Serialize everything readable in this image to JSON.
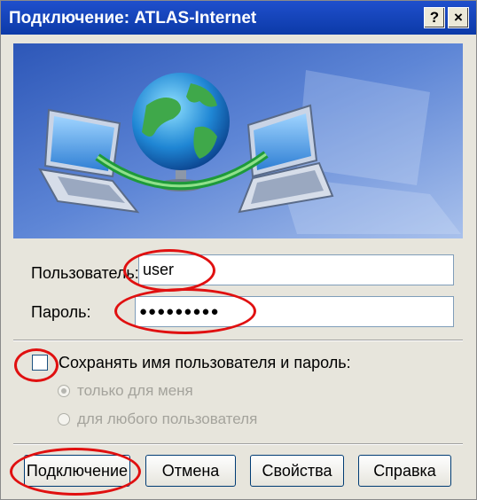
{
  "window": {
    "title": "Подключение: ATLAS-Internet",
    "help_button": "?",
    "close_button": "×"
  },
  "form": {
    "user_label": "Пользователь:",
    "user_value": "user",
    "password_label": "Пароль:",
    "password_value": "●●●●●●●●●",
    "save_checkbox_label": "Сохранять имя пользователя и пароль:",
    "save_checked": false,
    "radio_only_me": "только для меня",
    "radio_any_user": "для любого пользователя",
    "selected_radio": "только для меня"
  },
  "buttons": {
    "connect": "Подключение",
    "cancel": "Отмена",
    "properties": "Свойства",
    "help": "Справка"
  },
  "colors": {
    "titlebar": "#0c3aa8",
    "annotation": "#e01010",
    "banner_bg": "#3f6bc4"
  },
  "icons": [
    "laptop-icon",
    "globe-icon",
    "network-arc-icon"
  ]
}
